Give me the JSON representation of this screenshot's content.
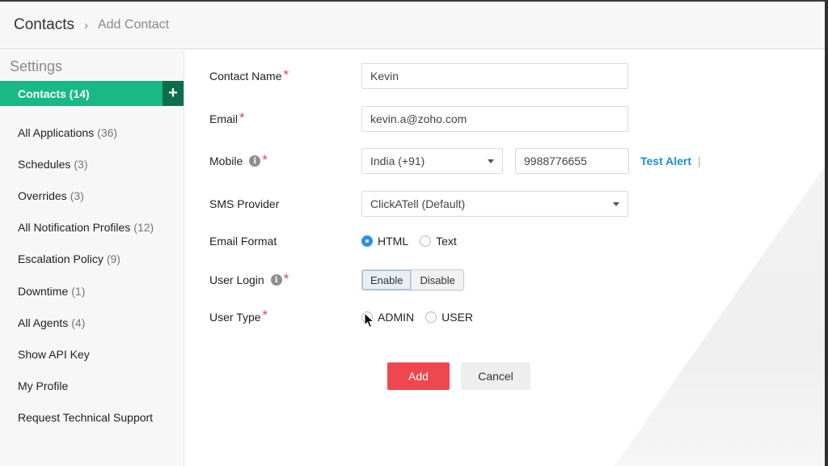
{
  "breadcrumb": {
    "root": "Contacts",
    "separator": "›",
    "current": "Add Contact"
  },
  "sidebar": {
    "title": "Settings",
    "active": {
      "label": "Contacts (14)",
      "add_icon": "+"
    },
    "items": [
      {
        "label": "All Applications",
        "count": "(36)"
      },
      {
        "label": "Schedules",
        "count": "(3)"
      },
      {
        "label": "Overrides",
        "count": "(3)"
      },
      {
        "label": "All Notification Profiles",
        "count": "(12)"
      },
      {
        "label": "Escalation Policy",
        "count": "(9)"
      },
      {
        "label": "Downtime",
        "count": "(1)"
      },
      {
        "label": "All Agents",
        "count": "(4)"
      },
      {
        "label": "Show API Key",
        "count": ""
      },
      {
        "label": "My Profile",
        "count": ""
      },
      {
        "label": "Request Technical Support",
        "count": ""
      }
    ]
  },
  "form": {
    "required_mark": "*",
    "info_glyph": "i",
    "contact_name": {
      "label": "Contact Name",
      "value": "Kevin"
    },
    "email": {
      "label": "Email",
      "value": "kevin.a@zoho.com"
    },
    "mobile": {
      "label": "Mobile",
      "country": "India (+91)",
      "number": "9988776655",
      "test_alert": "Test Alert",
      "pipe": "|"
    },
    "sms_provider": {
      "label": "SMS Provider",
      "value": "ClickATell (Default)"
    },
    "email_format": {
      "label": "Email Format",
      "options": [
        "HTML",
        "Text"
      ],
      "selected": "HTML"
    },
    "user_login": {
      "label": "User Login",
      "options": [
        "Enable",
        "Disable"
      ],
      "selected": "Enable"
    },
    "user_type": {
      "label": "User Type",
      "options": [
        "ADMIN",
        "USER"
      ],
      "selected": ""
    }
  },
  "actions": {
    "add": "Add",
    "cancel": "Cancel"
  },
  "colors": {
    "accent_green": "#19b985",
    "accent_dark_green": "#0f6e4a",
    "primary_red": "#ef4750",
    "link_blue": "#1c8ed6",
    "radio_blue": "#2d8ff0"
  }
}
